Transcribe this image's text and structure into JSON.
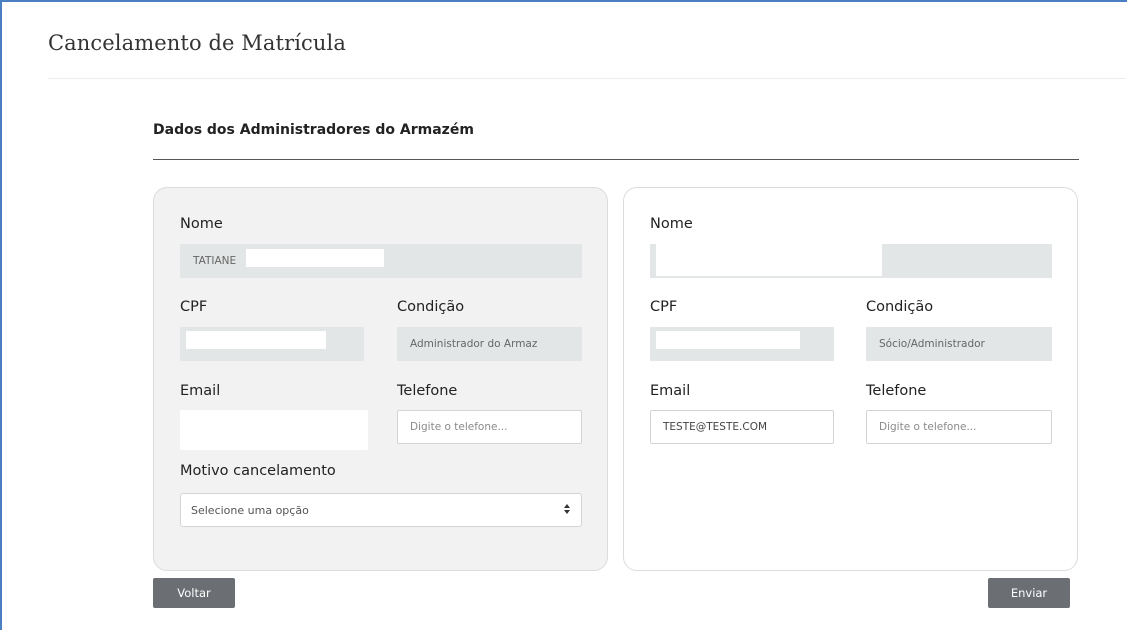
{
  "page": {
    "title": "Cancelamento de Matrícula"
  },
  "section": {
    "title": "Dados dos Administradores do Armazém"
  },
  "left_card": {
    "nome_label": "Nome",
    "nome_value": "TATIANE",
    "cpf_label": "CPF",
    "cpf_value": "",
    "condicao_label": "Condição",
    "condicao_value": "Administrador do Armaz",
    "email_label": "Email",
    "email_value": "",
    "telefone_label": "Telefone",
    "telefone_placeholder": "Digite o telefone...",
    "motivo_label": "Motivo cancelamento",
    "motivo_selected": "Selecione uma opção"
  },
  "right_card": {
    "nome_label": "Nome",
    "nome_value": "",
    "cpf_label": "CPF",
    "cpf_value": "",
    "condicao_label": "Condição",
    "condicao_value": "Sócio/Administrador",
    "email_label": "Email",
    "email_value": "TESTE@TESTE.COM",
    "telefone_label": "Telefone",
    "telefone_placeholder": "Digite o telefone..."
  },
  "buttons": {
    "back_label": "Voltar",
    "send_label": "Enviar"
  },
  "colors": {
    "accent_border": "#4a7fc4",
    "button_bg": "#6b6e72",
    "readonly_bg": "#e3e6e6",
    "card_bg": "#f2f2f2"
  },
  "icons": {
    "select_arrow": "sort-arrows-icon"
  }
}
